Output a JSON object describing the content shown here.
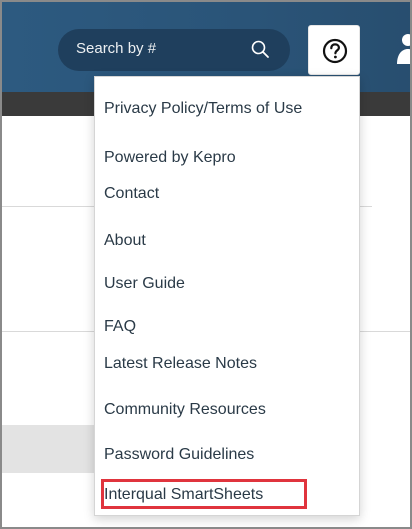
{
  "header": {
    "search_placeholder": "Search by #",
    "search_icon": "search-icon",
    "help_icon": "question-circle-icon",
    "user_icon": "user-icon"
  },
  "help_menu": {
    "items": [
      {
        "label": "Privacy Policy/Terms of Use"
      },
      {
        "label": "Powered by Kepro"
      },
      {
        "label": "Contact"
      },
      {
        "label": "About"
      },
      {
        "label": "User Guide"
      },
      {
        "label": "FAQ"
      },
      {
        "label": "Latest Release Notes"
      },
      {
        "label": "Community Resources"
      },
      {
        "label": "Password Guidelines"
      },
      {
        "label": "Interqual SmartSheets"
      }
    ],
    "highlight_color": "#e0343d"
  },
  "colors": {
    "header_bg": "#2d5a80",
    "search_bg": "#1f3f5d",
    "subbar_bg": "#3a3a3a",
    "menu_text": "#2a3a47"
  }
}
